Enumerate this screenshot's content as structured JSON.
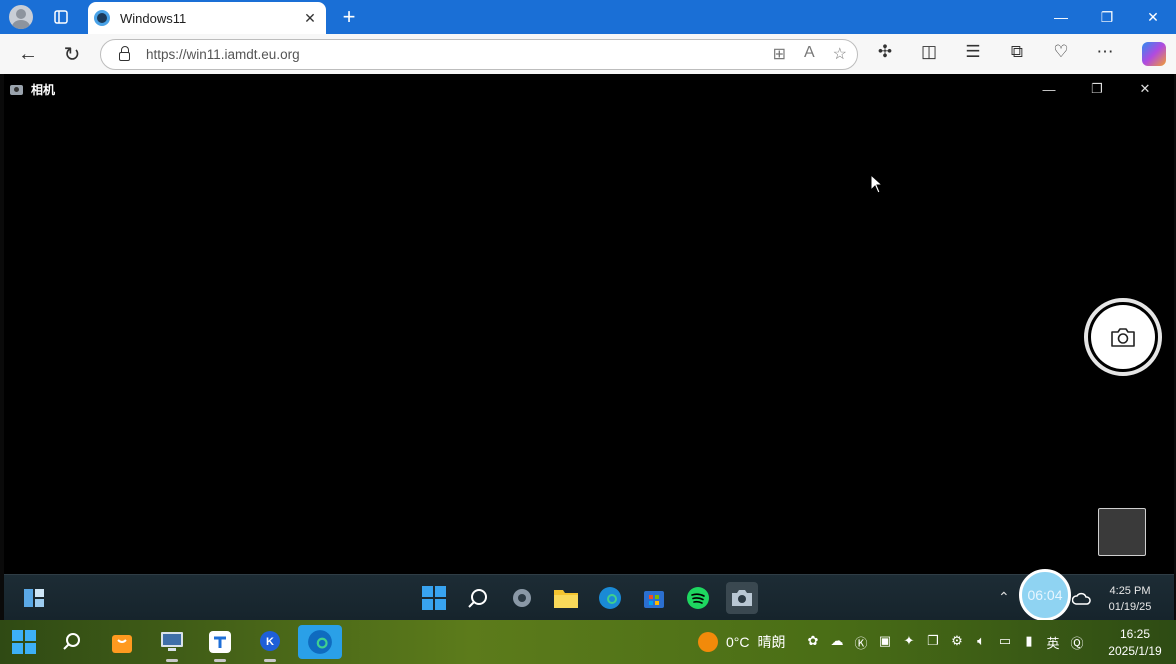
{
  "browser": {
    "tab_title": "Windows11",
    "url": "https://win11.iamdt.eu.org",
    "new_tab_symbol": "+",
    "controls": {
      "minimize": "—",
      "restore": "❐",
      "close": "✕"
    }
  },
  "app": {
    "title": "相机",
    "controls": {
      "minimize": "—",
      "restore": "❐",
      "close": "✕"
    }
  },
  "inner_taskbar": {
    "clock_bubble": "06:04",
    "time": "4:25 PM",
    "date": "01/19/25",
    "apps": [
      "widgets-icon",
      "start-icon",
      "search-icon",
      "settings-icon",
      "file-explorer-icon",
      "edge-icon",
      "store-icon",
      "spotify-icon",
      "camera-icon"
    ]
  },
  "host_taskbar": {
    "weather_temp": "0°C",
    "weather_text": "晴朗",
    "ime": "英",
    "time": "16:25",
    "date": "2025/1/19"
  },
  "colors": {
    "tabbar": "#1a6fd6",
    "host_taskbar_green": "#5c7b1b",
    "clock_bubble": "#8fd3f2"
  }
}
